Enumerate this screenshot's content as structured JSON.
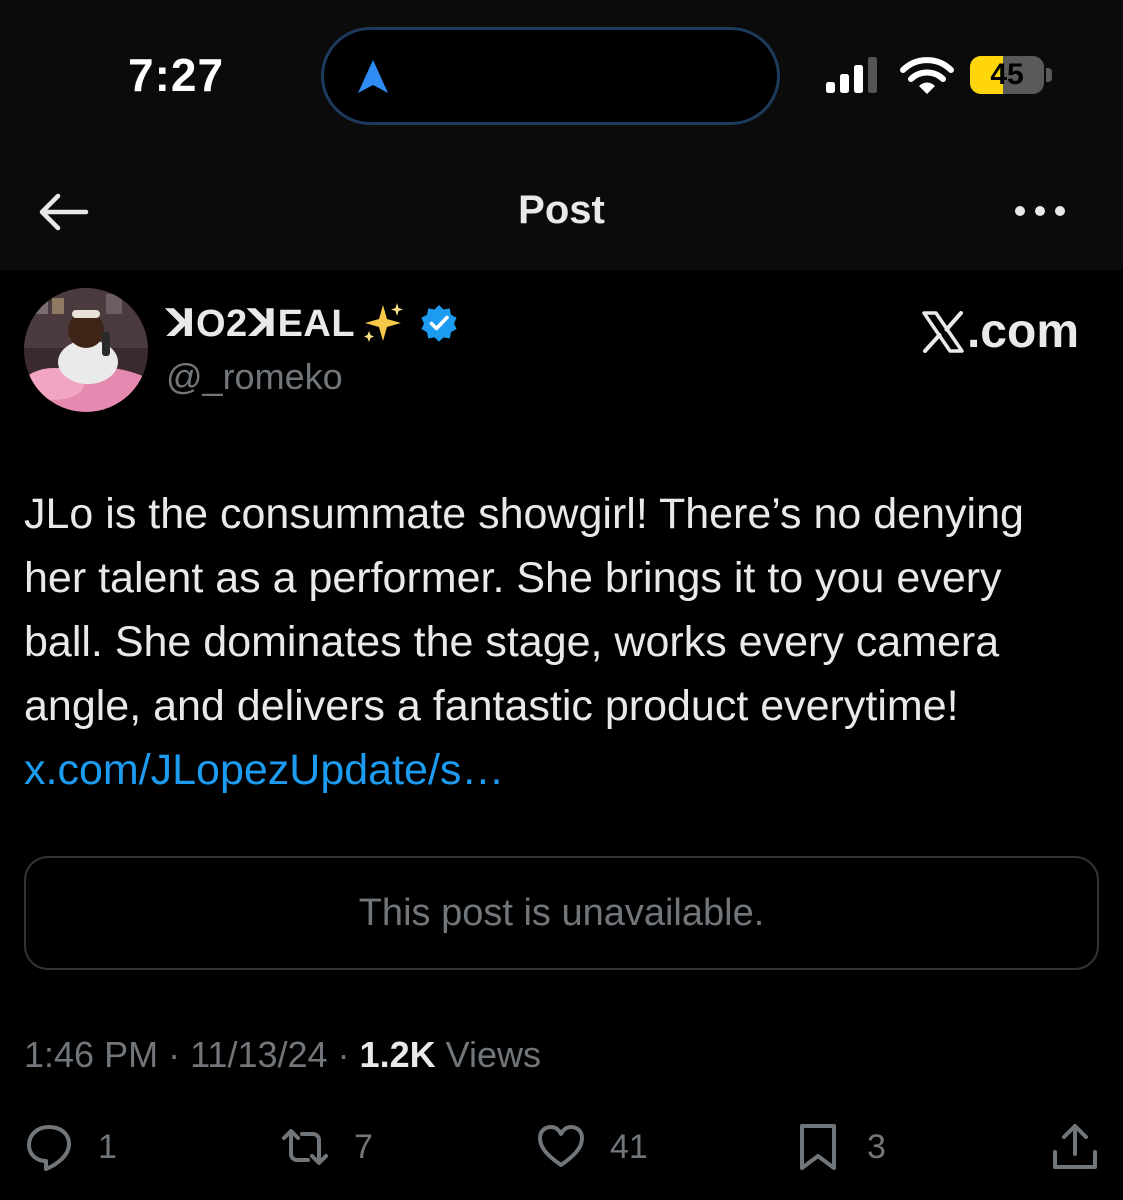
{
  "status_bar": {
    "time": "7:27",
    "battery_level": "45",
    "battery_fraction": 0.45,
    "icons": [
      "navigation-arrow-icon",
      "cellular-signal-icon",
      "wifi-icon",
      "battery-icon"
    ]
  },
  "header": {
    "title": "Post",
    "back_icon": "back-arrow-icon",
    "more_icon": "more-options-icon"
  },
  "post": {
    "display_name": "ꓘO2ꓘEAL",
    "handle": "@_romeko",
    "verified": true,
    "brand": ".com",
    "text": "JLo is the consummate showgirl! There’s no denying her talent as a performer. She brings it to you every ball. She dominates the stage, works every camera angle, and delivers a fantastic product everytime! ",
    "link_text": "x.com/JLopezUpdate/s…",
    "quoted_post_message": "This post is unavailable.",
    "time": "1:46 PM",
    "date": "11/13/24",
    "views_count": "1.2K",
    "views_label": "Views",
    "separator": " · "
  },
  "actions": {
    "replies": "1",
    "reposts": "7",
    "likes": "41",
    "bookmarks": "3"
  },
  "colors": {
    "background": "#000000",
    "header_background": "#0b0b0b",
    "primary_text": "#e7e9ea",
    "secondary_text": "#71767b",
    "link": "#1d9bf0",
    "verified_badge": "#1d9bf0",
    "battery_fill": "#ffd60a",
    "island_border": "#1d3a5c"
  }
}
